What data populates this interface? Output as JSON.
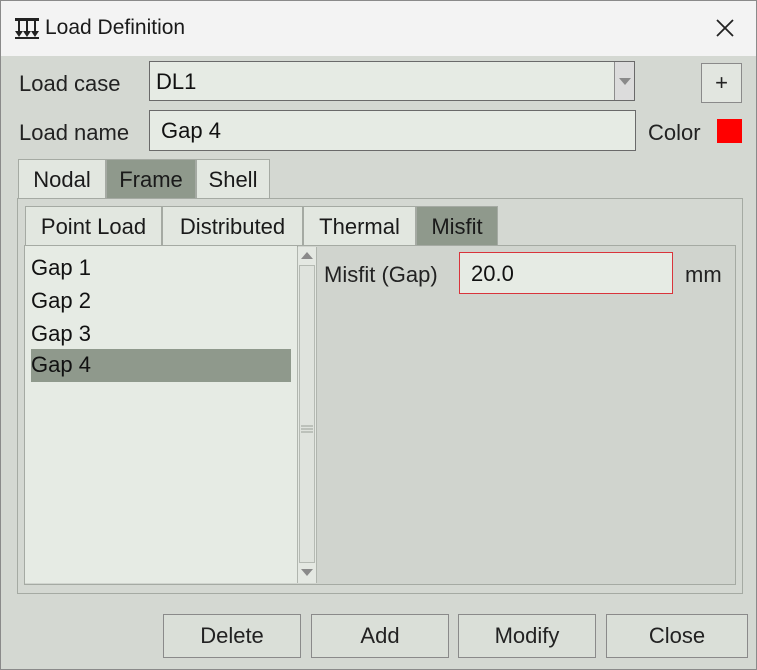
{
  "window": {
    "title": "Load Definition"
  },
  "form": {
    "load_case_label": "Load case",
    "load_case_value": "DL1",
    "add_case_label": "+",
    "load_name_label": "Load name",
    "load_name_value": "Gap 4",
    "color_label": "Color",
    "color_value": "#ff0000"
  },
  "tabs": [
    {
      "label": "Nodal",
      "active": false
    },
    {
      "label": "Frame",
      "active": true
    },
    {
      "label": "Shell",
      "active": false
    }
  ],
  "subtabs": [
    {
      "label": "Point Load",
      "active": false
    },
    {
      "label": "Distributed",
      "active": false
    },
    {
      "label": "Thermal",
      "active": false
    },
    {
      "label": "Misfit",
      "active": true
    }
  ],
  "list": {
    "items": [
      {
        "label": "Gap 1",
        "selected": false
      },
      {
        "label": "Gap 2",
        "selected": false
      },
      {
        "label": "Gap 3",
        "selected": false
      },
      {
        "label": "Gap 4",
        "selected": true
      }
    ]
  },
  "misfit": {
    "label": "Misfit (Gap)",
    "value": "20.0",
    "unit": "mm"
  },
  "buttons": {
    "delete": "Delete",
    "add": "Add",
    "modify": "Modify",
    "close": "Close"
  }
}
